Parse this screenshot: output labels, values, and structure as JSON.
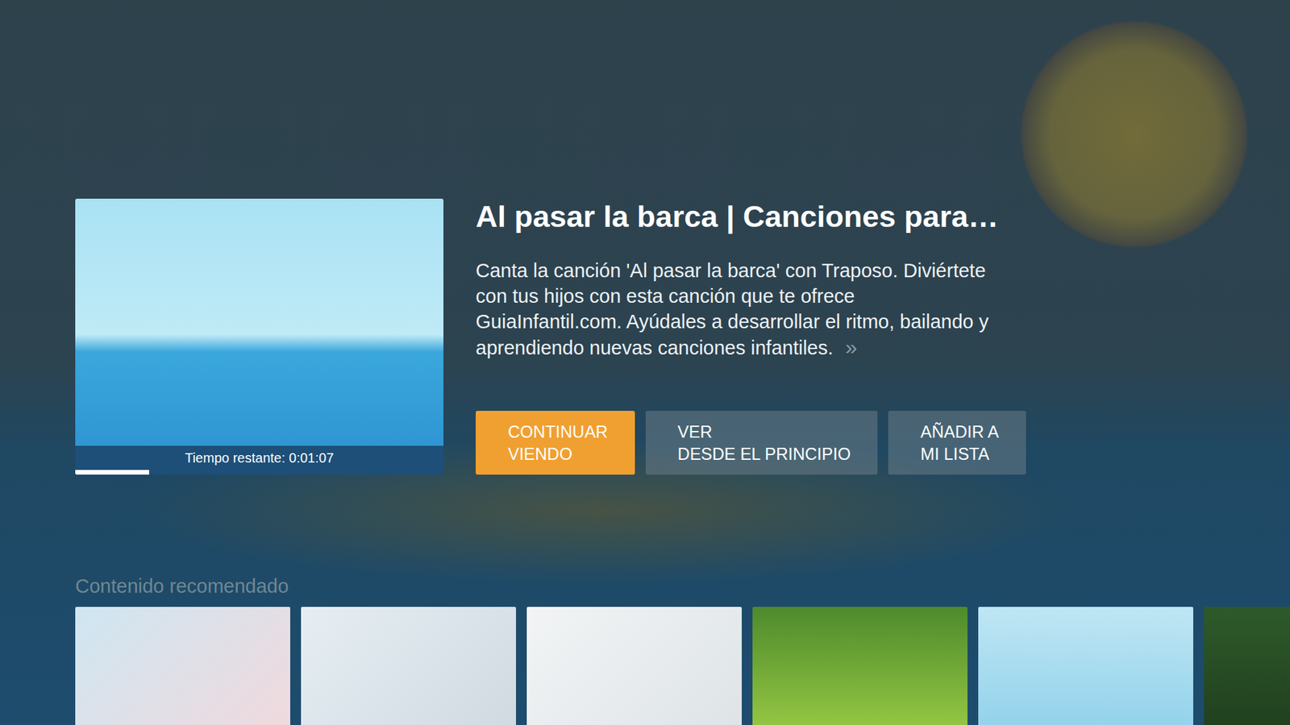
{
  "content": {
    "title": "Al pasar la barca | Canciones para…",
    "description": "Canta la canción 'Al pasar la barca' con Traposo. Diviértete con tus hijos con esta canción que te ofrece GuiaInfantil.com. Ayúdales a desarrollar el ritmo, bailando y aprendiendo nuevas canciones infantiles.",
    "more_icon": "»",
    "thumbnail": {
      "remaining": "Tiempo restante: 0:01:07",
      "level": 0.2
    }
  },
  "buttons": [
    {
      "lines": [
        "CONTINUAR",
        "VIENDO"
      ],
      "selected": true
    },
    {
      "lines": [
        "VER",
        "DESDE EL PRINCIPIO"
      ],
      "selected": false
    },
    {
      "lines": [
        "AÑADIR A",
        "MI LISTA"
      ],
      "selected": false
    }
  ],
  "recommended": {
    "title": "Contenido recomendado",
    "items": [
      {
        "kind": "thumbnail"
      },
      {
        "kind": "thumbnail"
      },
      {
        "kind": "thumbnail"
      },
      {
        "kind": "thumbnail"
      },
      {
        "kind": "thumbnail"
      },
      {
        "kind": "thumbnail"
      }
    ]
  }
}
